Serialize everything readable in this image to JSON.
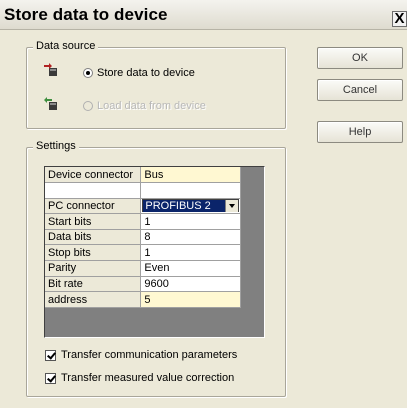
{
  "window": {
    "title": "Store data to device",
    "close_label": "X"
  },
  "data_source": {
    "legend": "Data source",
    "store_option": "Store data to device",
    "load_option": "Load data from device"
  },
  "buttons": {
    "ok": "OK",
    "cancel": "Cancel",
    "help": "Help"
  },
  "settings": {
    "legend": "Settings",
    "rows": [
      {
        "name": "Device connector",
        "value": "Bus"
      },
      {
        "name": "",
        "value": ""
      },
      {
        "name": "PC connector",
        "value": "PROFIBUS 2"
      },
      {
        "name": "Start bits",
        "value": "1"
      },
      {
        "name": "Data bits",
        "value": "8"
      },
      {
        "name": "Stop bits",
        "value": "1"
      },
      {
        "name": "Parity",
        "value": "Even"
      },
      {
        "name": "Bit rate",
        "value": "9600"
      },
      {
        "name": "address",
        "value": "5"
      }
    ],
    "transfer_comm": "Transfer communication parameters",
    "transfer_meas": "Transfer measured value correction"
  },
  "colors": {
    "dialog_bg": "#ece9d8",
    "highlight_cell": "#fff8d2",
    "selection": "#0a246a"
  }
}
